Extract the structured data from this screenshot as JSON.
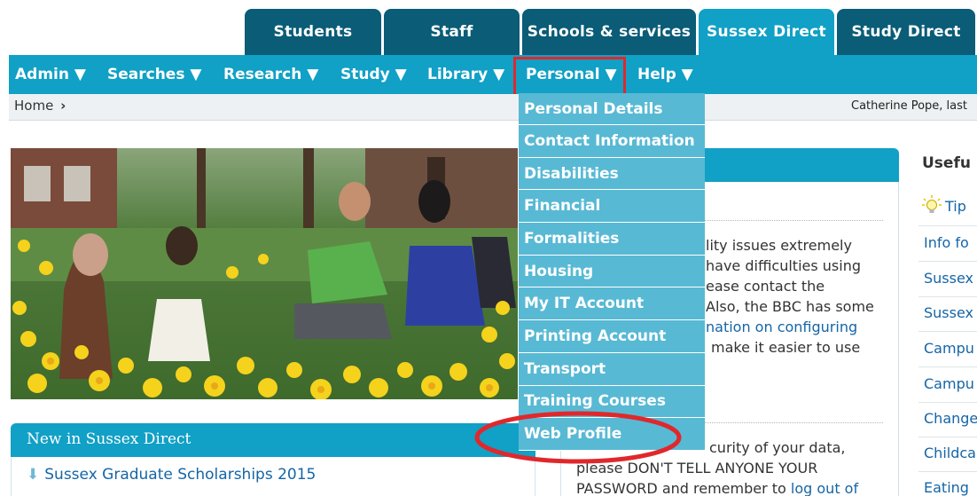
{
  "top_tabs": [
    {
      "label": "Students"
    },
    {
      "label": "Staff"
    },
    {
      "label": "Schools & services"
    },
    {
      "label": "Sussex Direct",
      "active": true
    },
    {
      "label": "Study Direct"
    }
  ],
  "nav": {
    "items": [
      {
        "label": "Admin ▼"
      },
      {
        "label": "Searches ▼"
      },
      {
        "label": "Research ▼"
      },
      {
        "label": "Study ▼"
      },
      {
        "label": "Library ▼"
      },
      {
        "label": "Personal ▼",
        "highlighted": true
      },
      {
        "label": "Help ▼"
      }
    ]
  },
  "breadcrumb": {
    "home": "Home",
    "separator": "›"
  },
  "user_line": "Catherine Pope, last",
  "personal_menu": {
    "items": [
      {
        "label": "Personal Details"
      },
      {
        "label": "Contact Information"
      },
      {
        "label": "Disabilities"
      },
      {
        "label": "Financial"
      },
      {
        "label": "Formalities"
      },
      {
        "label": "Housing"
      },
      {
        "label": "My IT Account"
      },
      {
        "label": "Printing Account"
      },
      {
        "label": "Transport"
      },
      {
        "label": "Training Courses"
      },
      {
        "label": "Web Profile",
        "circled": true
      }
    ]
  },
  "new_panel": {
    "title": "New in Sussex Direct",
    "items": [
      {
        "label": "Sussex Graduate Scholarships 2015"
      }
    ]
  },
  "info_panel": {
    "lines": [
      {
        "text": "lity issues extremely",
        "link": false
      },
      {
        "text": "have difficulties using",
        "link": false
      },
      {
        "text": "ease contact the",
        "link": false
      },
      {
        "text": "Also, the BBC has some",
        "link": false
      },
      {
        "text": "nation on configuring",
        "link": true
      },
      {
        "text": "make it easier to use",
        "link": false
      }
    ],
    "security": {
      "line1": "curity of your data,",
      "line2": "please DON'T TELL ANYONE YOUR",
      "line3_text": "PASSWORD and remember to ",
      "line3_link": "log out of"
    }
  },
  "right_column": {
    "heading": "Usefu",
    "tip": "Tip",
    "links": [
      "Info fo",
      "Sussex",
      "Sussex",
      "Campu",
      "Campu",
      "Change",
      "Childca",
      "Eating"
    ]
  },
  "colors": {
    "tab_dark": "#0a5c77",
    "accent": "#11a0c6",
    "dropdown": "#58b9d4",
    "highlight_red": "#e0282c",
    "link": "#1565a6"
  },
  "icons": {
    "tip": "lightbulb-icon",
    "news": "download-arrow-icon"
  }
}
